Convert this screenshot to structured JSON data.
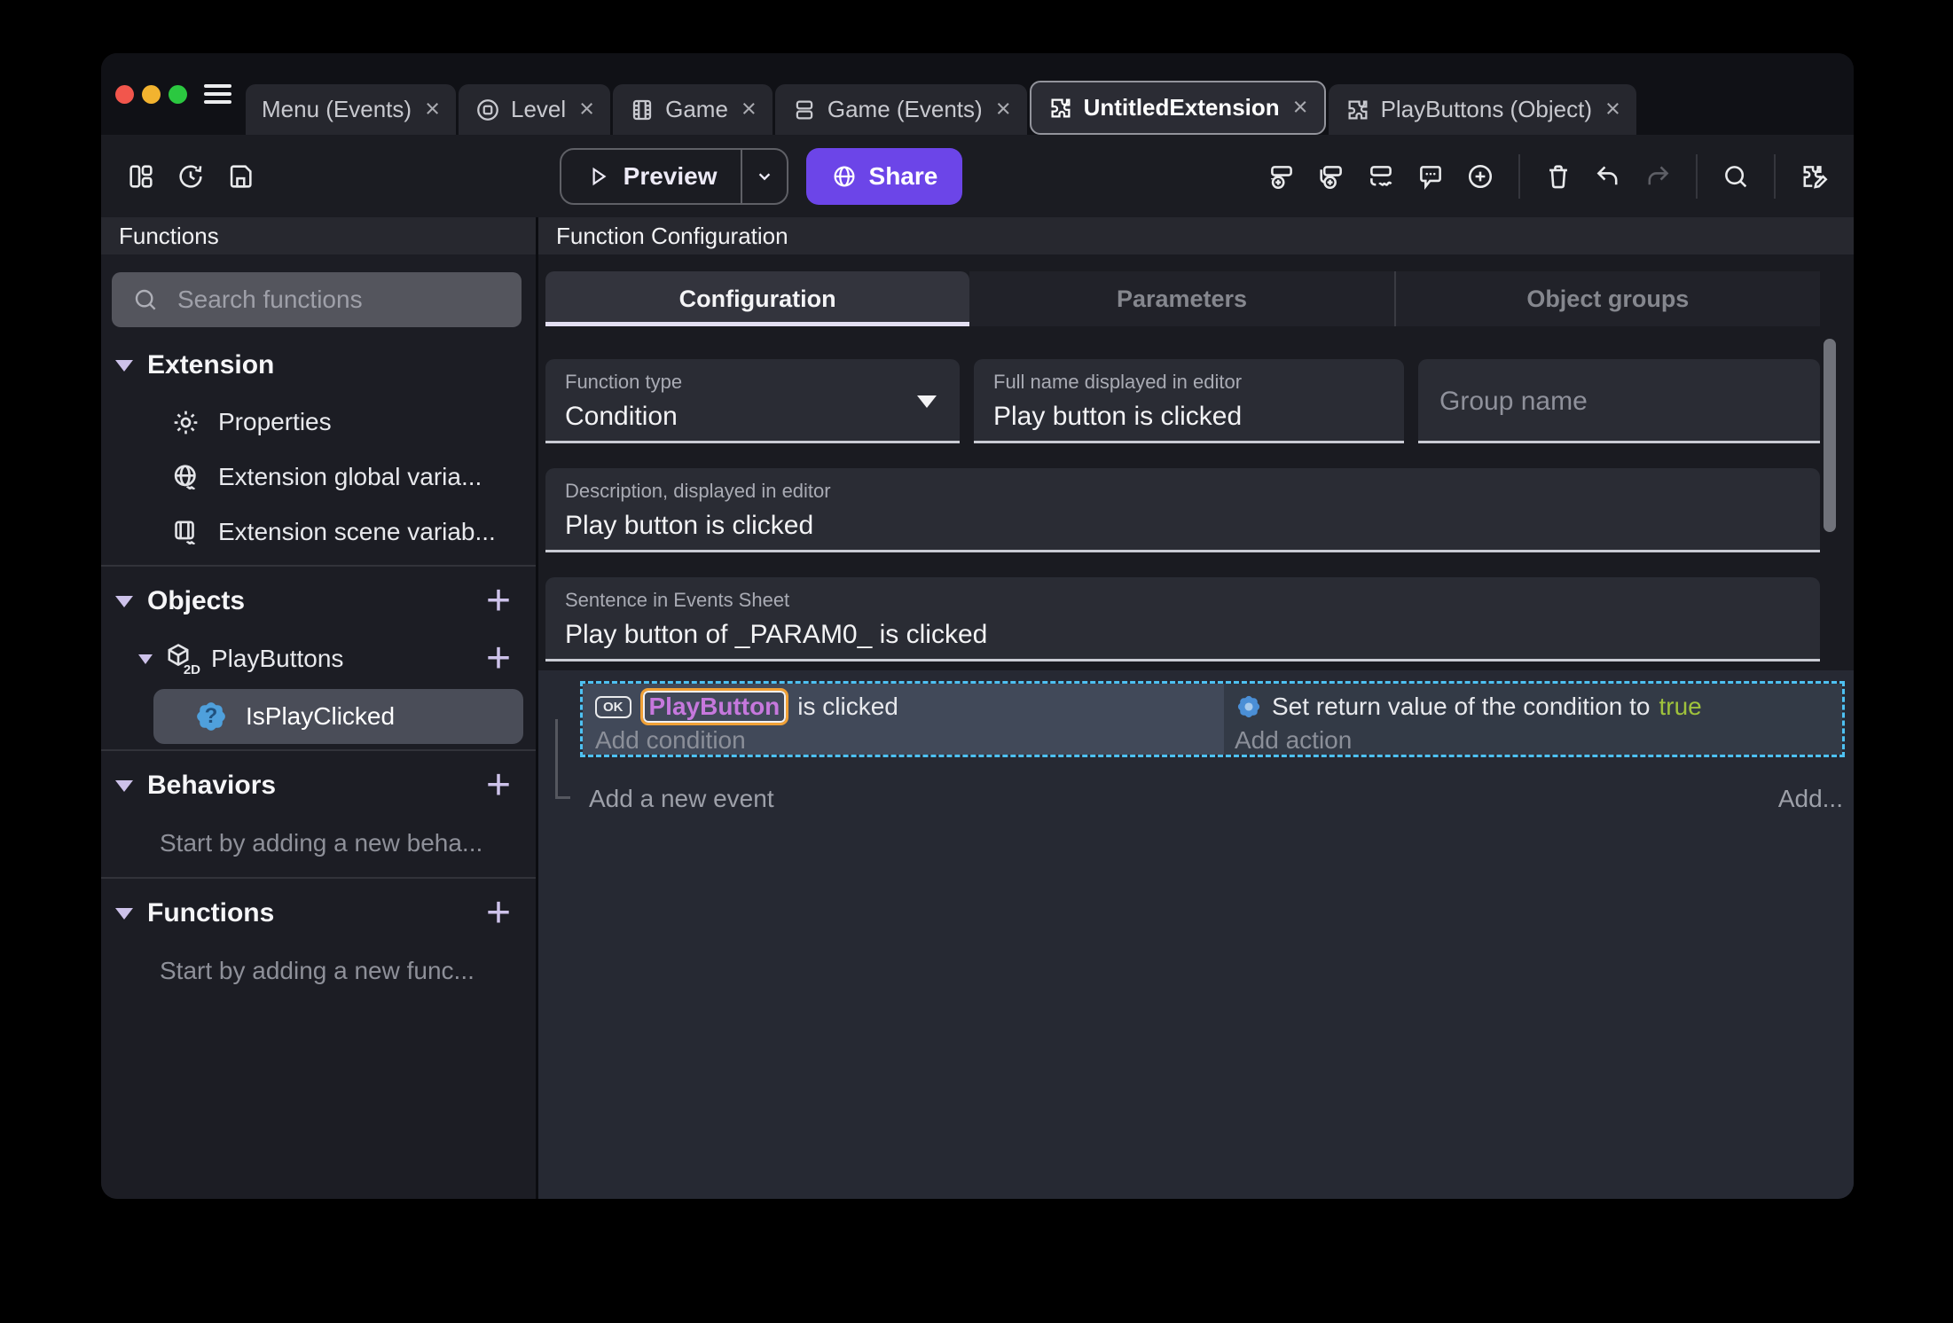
{
  "colors": {
    "share_button": "#6C45E8",
    "selection_dashed_border": "#4EC1F2",
    "object_name_text": "#C678DD",
    "object_name_border": "#F0A137",
    "boolean_true_text": "#9FC23C",
    "function_icon_blue": "#4FA0DC"
  },
  "window": {
    "tabs": [
      {
        "label": "Menu (Events)",
        "close": "×"
      },
      {
        "label": "Level",
        "close": "×"
      },
      {
        "label": "Game",
        "close": "×"
      },
      {
        "label": "Game (Events)",
        "close": "×"
      },
      {
        "label": "UntitledExtension",
        "close": "×"
      },
      {
        "label": "PlayButtons (Object)",
        "close": "×"
      }
    ]
  },
  "toolbar": {
    "preview_label": "Preview",
    "share_label": "Share"
  },
  "sidebar": {
    "header": "Functions",
    "search_placeholder": "Search functions",
    "sections": {
      "extension": {
        "label": "Extension",
        "items": [
          {
            "label": "Properties"
          },
          {
            "label": "Extension global varia..."
          },
          {
            "label": "Extension scene variab..."
          }
        ]
      },
      "objects": {
        "label": "Objects",
        "add_glyph": "+",
        "object": {
          "label": "PlayButtons",
          "badge": "2D",
          "add_glyph": "+"
        },
        "selected_function": {
          "label": "IsPlayClicked",
          "icon_glyph": "?"
        }
      },
      "behaviors": {
        "label": "Behaviors",
        "add_glyph": "+",
        "empty": "Start by adding a new beha..."
      },
      "functions": {
        "label": "Functions",
        "add_glyph": "+",
        "empty": "Start by adding a new func..."
      }
    }
  },
  "main": {
    "header": "Function Configuration",
    "tabs": [
      {
        "label": "Configuration"
      },
      {
        "label": "Parameters"
      },
      {
        "label": "Object groups"
      }
    ],
    "fields": {
      "function_type": {
        "label": "Function type",
        "value": "Condition"
      },
      "full_name": {
        "label": "Full name displayed in editor",
        "value": "Play button is clicked"
      },
      "group_name": {
        "placeholder": "Group name"
      },
      "description": {
        "label": "Description, displayed in editor",
        "value": "Play button is clicked"
      },
      "sentence": {
        "label": "Sentence in Events Sheet",
        "value": "Play button of _PARAM0_ is clicked"
      }
    },
    "events": {
      "condition": {
        "object_button_glyph": "OK",
        "object_name": "PlayButton",
        "text_after": "is clicked",
        "add_label": "Add condition"
      },
      "action": {
        "text_before": "Set return value of the condition to",
        "value": "true",
        "add_label": "Add action"
      },
      "add_new_event_label": "Add a new event",
      "add_button_label": "Add..."
    }
  }
}
